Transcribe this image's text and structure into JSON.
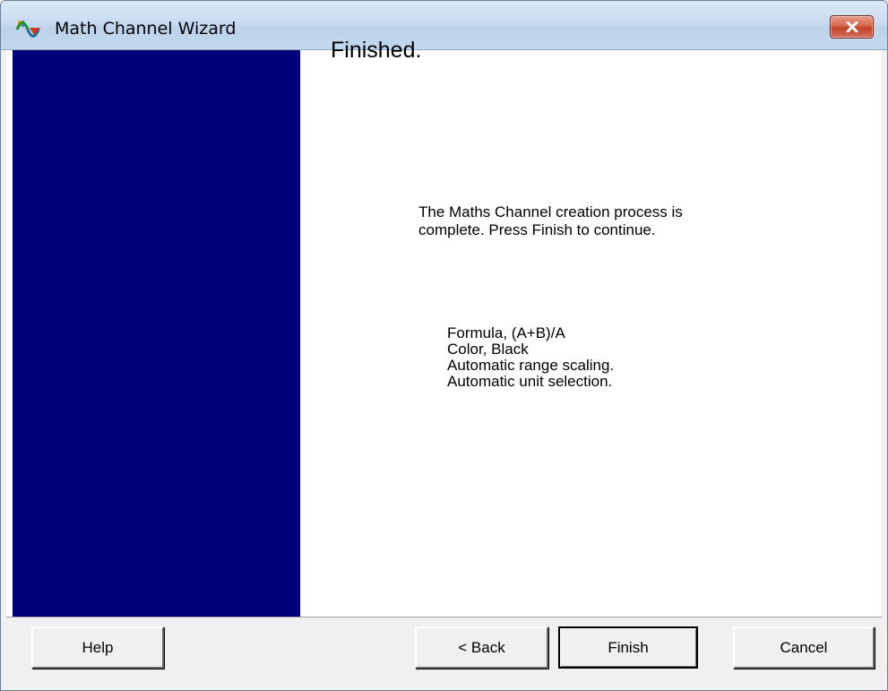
{
  "window": {
    "title": "Math Channel Wizard",
    "app_icon": "waveform-icon",
    "close_icon": "close-icon"
  },
  "banner": {
    "color": "#000078"
  },
  "page": {
    "heading": "Finished.",
    "description_line1": "The Maths Channel creation process is",
    "description_line2": "complete. Press Finish to continue.",
    "summary": [
      "Formula, (A+B)/A",
      "Color, Black",
      "Automatic range scaling.",
      "Automatic unit selection."
    ]
  },
  "buttons": {
    "help": "Help",
    "back": "< Back",
    "finish": "Finish",
    "cancel": "Cancel"
  }
}
